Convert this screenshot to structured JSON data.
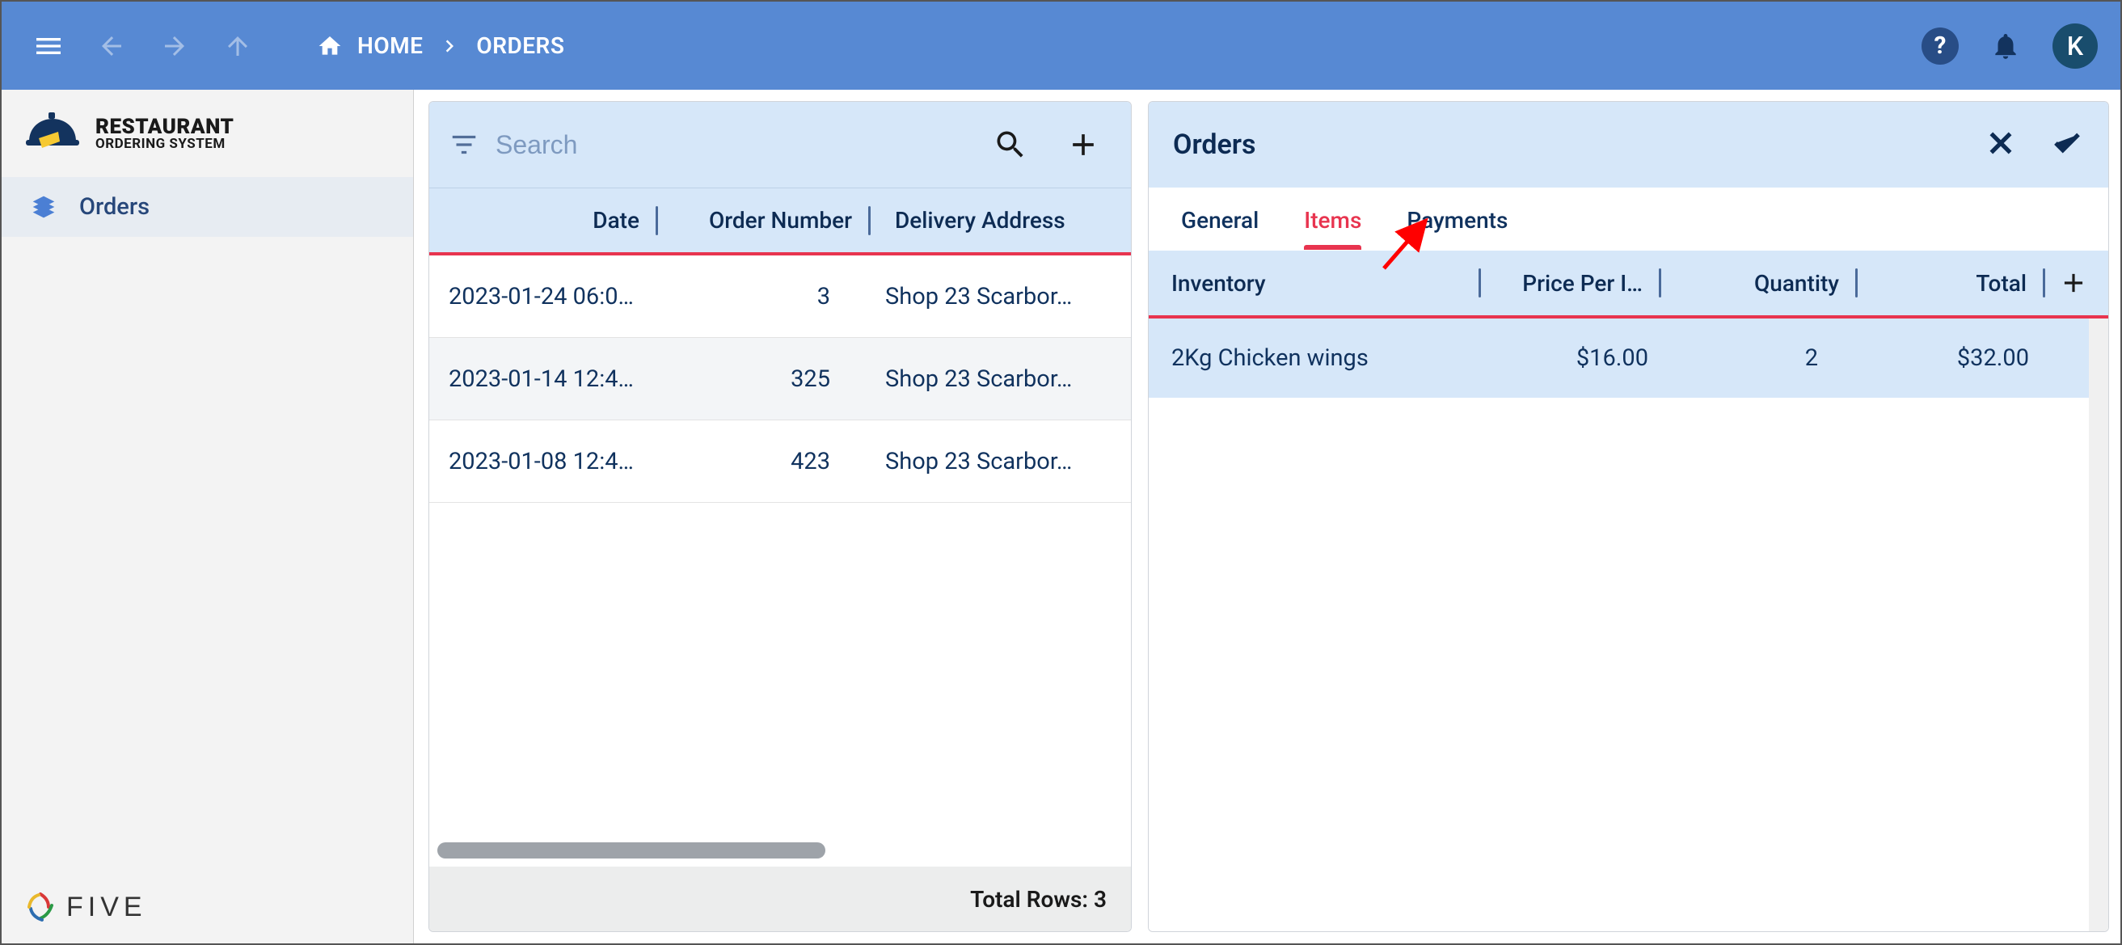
{
  "topbar": {
    "breadcrumb": [
      "HOME",
      "ORDERS"
    ],
    "avatar_initial": "K"
  },
  "brand": {
    "line1": "RESTAURANT",
    "line2": "ORDERING SYSTEM"
  },
  "sidebar": {
    "items": [
      {
        "label": "Orders"
      }
    ],
    "footer_brand": "FIVE"
  },
  "list": {
    "search_placeholder": "Search",
    "columns": [
      "Date",
      "Order Number",
      "Delivery Address"
    ],
    "rows": [
      {
        "date": "2023-01-24 06:0…",
        "order_number": "3",
        "address": "Shop 23 Scarbor…",
        "selected": false
      },
      {
        "date": "2023-01-14 12:4…",
        "order_number": "325",
        "address": "Shop 23 Scarbor…",
        "selected": true
      },
      {
        "date": "2023-01-08 12:4…",
        "order_number": "423",
        "address": "Shop 23 Scarbor…",
        "selected": false
      }
    ],
    "footer": "Total Rows: 3"
  },
  "detail": {
    "title": "Orders",
    "tabs": [
      {
        "label": "General",
        "active": false
      },
      {
        "label": "Items",
        "active": true
      },
      {
        "label": "Payments",
        "active": false
      }
    ],
    "columns": [
      "Inventory",
      "Price Per I…",
      "Quantity",
      "Total"
    ],
    "rows": [
      {
        "inventory": "2Kg Chicken wings",
        "price": "$16.00",
        "quantity": "2",
        "total": "$32.00"
      }
    ]
  }
}
